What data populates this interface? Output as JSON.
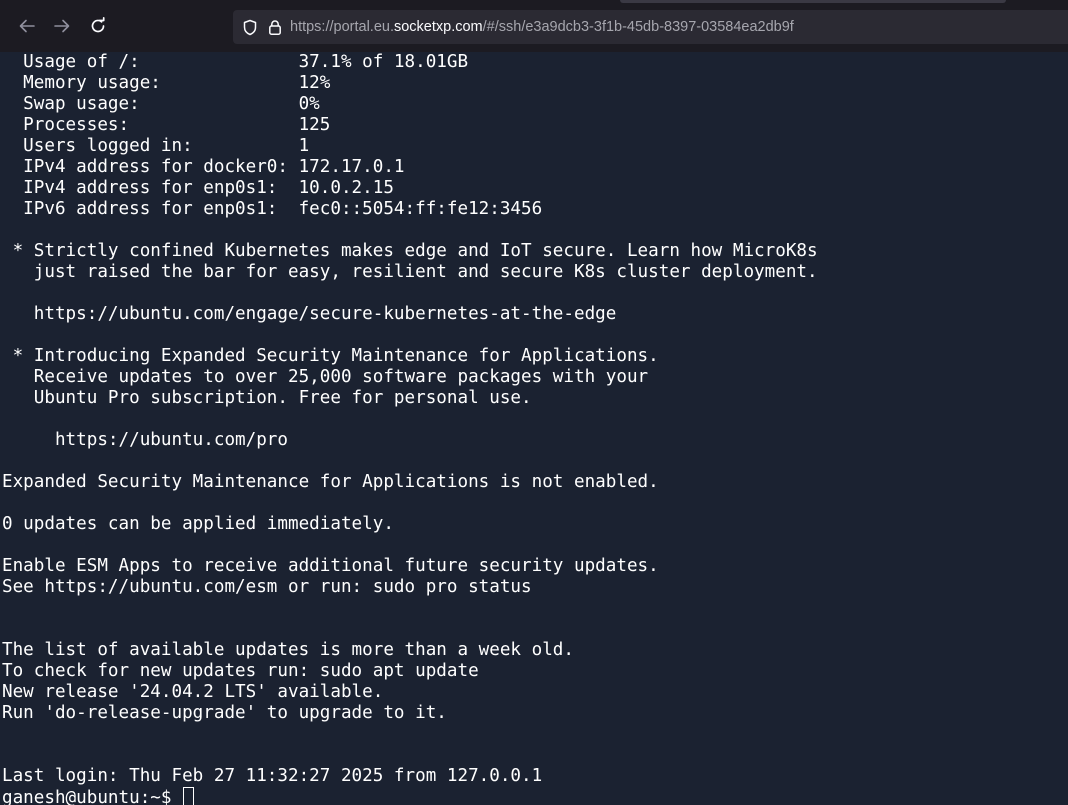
{
  "browser": {
    "url_prefix": "https://portal.eu.",
    "url_host": "socketxp.com",
    "url_path": "/#/ssh/e3a9dcb3-3f1b-45db-8397-03584ea2db9f",
    "icons": {
      "back": "arrow-left",
      "forward": "arrow-right",
      "reload": "reload",
      "shield": "shield",
      "lock": "lock"
    }
  },
  "terminal": {
    "lines": [
      "  Usage of /:               37.1% of 18.01GB",
      "  Memory usage:             12%",
      "  Swap usage:               0%",
      "  Processes:                125",
      "  Users logged in:          1",
      "  IPv4 address for docker0: 172.17.0.1",
      "  IPv4 address for enp0s1:  10.0.2.15",
      "  IPv6 address for enp0s1:  fec0::5054:ff:fe12:3456",
      "",
      " * Strictly confined Kubernetes makes edge and IoT secure. Learn how MicroK8s",
      "   just raised the bar for easy, resilient and secure K8s cluster deployment.",
      "",
      "   https://ubuntu.com/engage/secure-kubernetes-at-the-edge",
      "",
      " * Introducing Expanded Security Maintenance for Applications.",
      "   Receive updates to over 25,000 software packages with your",
      "   Ubuntu Pro subscription. Free for personal use.",
      "",
      "     https://ubuntu.com/pro",
      "",
      "Expanded Security Maintenance for Applications is not enabled.",
      "",
      "0 updates can be applied immediately.",
      "",
      "Enable ESM Apps to receive additional future security updates.",
      "See https://ubuntu.com/esm or run: sudo pro status",
      "",
      "",
      "The list of available updates is more than a week old.",
      "To check for new updates run: sudo apt update",
      "New release '24.04.2 LTS' available.",
      "Run 'do-release-upgrade' to upgrade to it.",
      "",
      "",
      "Last login: Thu Feb 27 11:32:27 2025 from 127.0.0.1"
    ],
    "prompt": "ganesh@ubuntu:~$ ",
    "colors": {
      "background": "#1b2231",
      "foreground": "#ffffff"
    }
  }
}
